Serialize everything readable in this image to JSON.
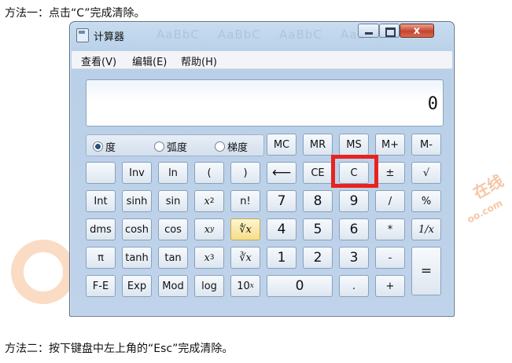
{
  "document": {
    "line_top": "方法一：点击“C”完成清除。",
    "line_bottom": "方法二：按下键盘中左上角的“Esc”完成清除。"
  },
  "window": {
    "title": "计算器",
    "title_ghosts": [
      "AaBbC",
      "AaBbC",
      "AaBbC",
      "AaBbC"
    ],
    "close_glyph": "x"
  },
  "menu": [
    "查看(V)",
    "编辑(E)",
    "帮助(H)"
  ],
  "display": {
    "value": "0"
  },
  "angle_modes": [
    {
      "label": "度",
      "selected": true
    },
    {
      "label": "弧度",
      "selected": false
    },
    {
      "label": "梯度",
      "selected": false
    }
  ],
  "keys": {
    "mc": "MC",
    "mr": "MR",
    "ms": "MS",
    "mplus": "M+",
    "mminus": "M-",
    "blank": "",
    "inv": "Inv",
    "ln": "ln",
    "lparen": "(",
    "rparen": ")",
    "backspace": "⟵",
    "ce": "CE",
    "c": "C",
    "plusminus": "±",
    "sqrt": "√",
    "int": "Int",
    "sinh": "sinh",
    "sin": "sin",
    "x2_base": "x",
    "x2_exp": "2",
    "nfact": "n!",
    "d7": "7",
    "d8": "8",
    "d9": "9",
    "div": "/",
    "pct": "%",
    "dms": "dms",
    "cosh": "cosh",
    "cos": "cos",
    "xy_base": "x",
    "xy_exp": "y",
    "yroot": "∜x",
    "d4": "4",
    "d5": "5",
    "d6": "6",
    "mul": "*",
    "recip": "1/x",
    "pi": "π",
    "tanh": "tanh",
    "tan": "tan",
    "x3_base": "x",
    "x3_exp": "3",
    "cuberoot": "∛x",
    "d1": "1",
    "d2": "2",
    "d3": "3",
    "sub": "-",
    "equals": "=",
    "fe": "F-E",
    "exp": "Exp",
    "mod": "Mod",
    "log": "log",
    "tenx_base": "10",
    "tenx_exp": "x",
    "d0": "0",
    "dot": ".",
    "add": "+"
  },
  "watermark": {
    "text1": "在线",
    "text2": "oo.com"
  }
}
